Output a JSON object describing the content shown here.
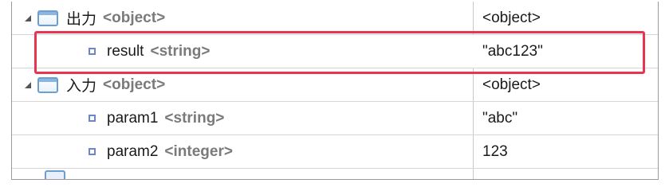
{
  "rows": [
    {
      "name": "出力",
      "type": "<object>",
      "value": "<object>",
      "icon": "object-icon",
      "expanded": true
    },
    {
      "name": "result",
      "type": "<string>",
      "value": "\"abc123\"",
      "icon": "property-icon",
      "highlighted": true
    },
    {
      "name": "入力",
      "type": "<object>",
      "value": "<object>",
      "icon": "object-icon",
      "expanded": true
    },
    {
      "name": "param1",
      "type": "<string>",
      "value": "\"abc\"",
      "icon": "property-icon"
    },
    {
      "name": "param2",
      "type": "<integer>",
      "value": "123",
      "icon": "property-icon"
    }
  ],
  "colors": {
    "highlight": "#e8344e",
    "object_icon": "#6b9fd1",
    "type_label": "#7a7a7a"
  }
}
